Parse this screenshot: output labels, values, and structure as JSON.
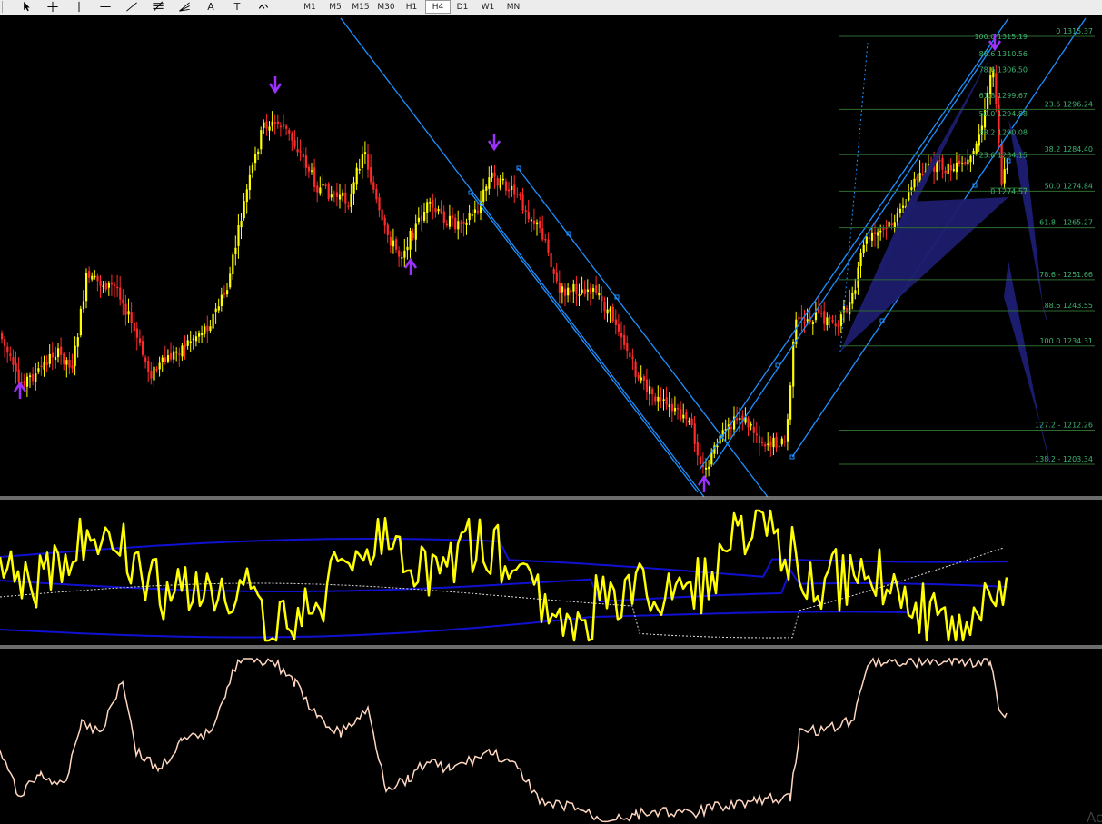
{
  "toolbar": {
    "tools": [
      {
        "name": "cursor-tool-icon",
        "glyph": "cursor"
      },
      {
        "name": "crosshair-tool-icon",
        "glyph": "cross"
      },
      {
        "name": "vertical-line-tool-icon",
        "glyph": "vline"
      },
      {
        "name": "horizontal-line-tool-icon",
        "glyph": "hline"
      },
      {
        "name": "trendline-tool-icon",
        "glyph": "trend"
      },
      {
        "name": "fibonacci-tool-icon",
        "glyph": "fibo"
      },
      {
        "name": "fibo-fan-tool-icon",
        "glyph": "fan"
      },
      {
        "name": "text-tool-icon",
        "label": "A"
      },
      {
        "name": "text-label-tool-icon",
        "label": "T"
      },
      {
        "name": "arrows-tool-icon",
        "glyph": "arrows"
      }
    ],
    "timeframes": [
      "M1",
      "M5",
      "M15",
      "M30",
      "H1",
      "H4",
      "D1",
      "W1",
      "MN"
    ],
    "selected_timeframe": "H4"
  },
  "fib_left": [
    {
      "label": "100.0 1315.19",
      "price": 1315.19
    },
    {
      "label": "88.6 1310.56",
      "price": 1310.56
    },
    {
      "label": "78.6 1306.50",
      "price": 1306.5
    },
    {
      "label": "61.8 1299.67",
      "price": 1299.67
    },
    {
      "label": "50.0 1294.88",
      "price": 1294.88
    },
    {
      "label": "38.2 1290.08",
      "price": 1290.08
    },
    {
      "label": "23.6 1284.15",
      "price": 1284.15
    },
    {
      "label": "0 1274.57",
      "price": 1274.57
    }
  ],
  "fib_right": [
    {
      "label": "0 1315.37",
      "price": 1315.37
    },
    {
      "label": "23.6 1296.24",
      "price": 1296.24
    },
    {
      "label": "38.2 1284.40",
      "price": 1284.4
    },
    {
      "label": "50.0 1274.84",
      "price": 1274.84
    },
    {
      "label": "61.8 - 1265.27",
      "price": 1265.27
    },
    {
      "label": "78.6 - 1251.66",
      "price": 1251.66
    },
    {
      "label": "88.6 1243.55",
      "price": 1243.55
    },
    {
      "label": "100.0 1234.31",
      "price": 1234.31
    },
    {
      "label": "127.2 - 1212.26",
      "price": 1212.26
    },
    {
      "label": "138.2 - 1203.34",
      "price": 1203.34
    }
  ],
  "colors": {
    "background": "#000000",
    "bull_candle": "#ffff00",
    "bear_candle": "#ff2a2a",
    "channel_line": "#1e90ff",
    "fib_line": "#2e6b2e",
    "fib_text": "#3cb371",
    "harmonic_fill": "#1c1c6e",
    "arrow_marker": "#9b30ff",
    "oscillator_line": "#ffff00",
    "band_line": "#1010d0",
    "bottom_line": "#ffd7c0"
  },
  "watermark": "Ac"
}
